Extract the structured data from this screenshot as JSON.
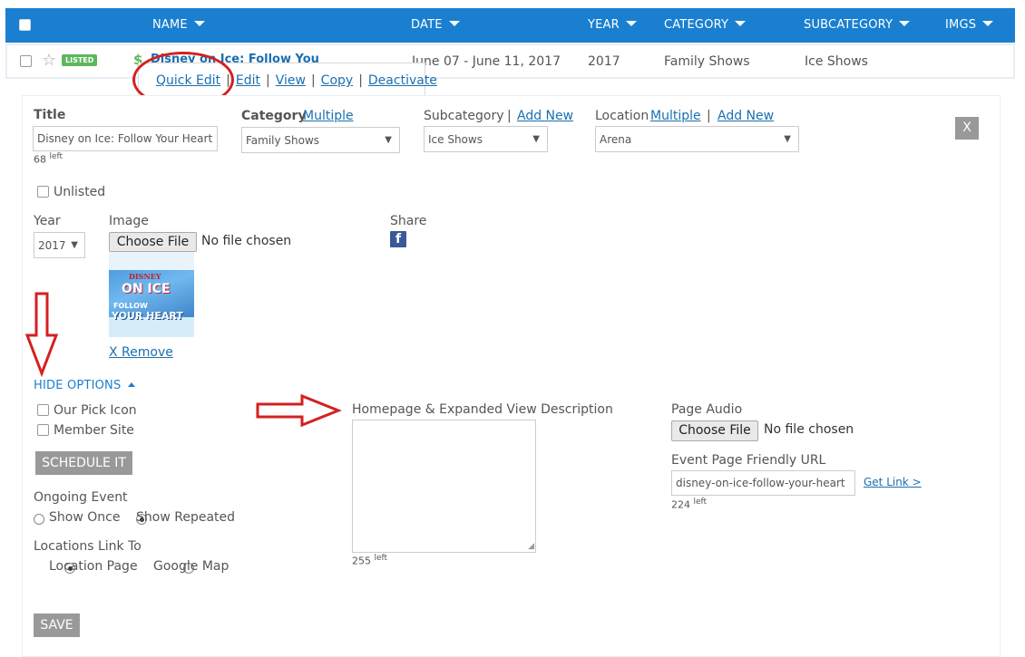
{
  "table_header": {
    "name": "NAME",
    "date": "DATE",
    "year": "YEAR",
    "category": "CATEGORY",
    "subcategory": "SUBCATEGORY",
    "imgs": "IMGS"
  },
  "row": {
    "badge": "LISTED",
    "name": "Disney on Ice: Follow You",
    "date": "June 07 - June 11, 2017",
    "year": "2017",
    "category": "Family Shows",
    "subcategory": "Ice Shows"
  },
  "popup": {
    "quick_edit": "Quick Edit",
    "edit": "Edit",
    "view": "View",
    "copy": "Copy",
    "deactivate": "Deactivate",
    "sep": "|"
  },
  "form": {
    "title_label": "Title",
    "title_value": "Disney on Ice: Follow Your Heart",
    "title_left": "68",
    "left_word": "left",
    "category_label": "Category",
    "multiple": "Multiple",
    "category_value": "Family Shows",
    "subcategory_label": "Subcategory",
    "add_new": "Add New",
    "subcategory_value": "Ice Shows",
    "location_label": "Location",
    "location_value": "Arena",
    "close": "X",
    "unlisted": "Unlisted",
    "year_label": "Year",
    "year_value": "2017",
    "image_label": "Image",
    "choose_file": "Choose File",
    "no_file": "No file chosen",
    "share_label": "Share",
    "fb_glyph": "f",
    "remove": "X Remove",
    "hide_options": "HIDE OPTIONS",
    "our_pick": "Our Pick Icon",
    "member_site": "Member Site",
    "schedule": "SCHEDULE IT",
    "ongoing_label": "Ongoing Event",
    "show_once": "Show Once",
    "show_repeated": "Show Repeated",
    "locations_label": "Locations Link To",
    "location_page": "Location Page",
    "google_map": "Google Map",
    "save": "SAVE",
    "desc_label": "Homepage & Expanded View Description",
    "desc_left": "255",
    "audio_label": "Page Audio",
    "url_label": "Event Page Friendly URL",
    "url_value": "disney-on-ice-follow-your-heart",
    "get_link": "Get Link >",
    "url_left": "224"
  },
  "poster": {
    "line1": "DISNEY",
    "line2": "ON ICE",
    "line3": "FOLLOW",
    "line4": "YOUR HEART"
  },
  "colors": {
    "header": "#1a7fd0",
    "link": "#1a6fb0",
    "listed": "#5cb85c",
    "annotation": "#d42020"
  }
}
